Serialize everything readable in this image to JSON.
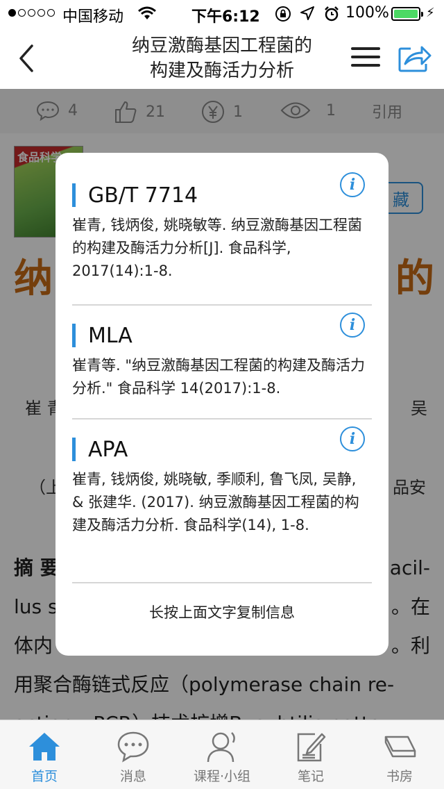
{
  "status_bar": {
    "carrier": "中国移动",
    "time": "下午6:12",
    "battery": "100%",
    "signal_bars_filled": 1,
    "signal_bars_total": 5
  },
  "nav": {
    "title_line1": "纳豆激酶基因工程菌的",
    "title_line2": "构建及酶活力分析",
    "back_icon": "chevron-left-icon",
    "menu_icon": "hamburger-icon",
    "share_icon": "share-icon"
  },
  "stats": {
    "comments": "4",
    "likes": "21",
    "price": "1",
    "views": "1",
    "cite_label": "引用"
  },
  "article": {
    "cover_title": "食品科学",
    "favorite_label": "藏",
    "title_left": "纳",
    "title_right": "的",
    "author_left": "崔 青",
    "author_right": "吴",
    "affil_left": "（上",
    "affil_right": "品安",
    "abstract": [
      {
        "left": "摘 要",
        "right": "acil-"
      },
      {
        "left": "lus s",
        "right": "。在"
      },
      {
        "left": "体内",
        "right": "。利"
      },
      {
        "left": "用聚合酶链式反应（polymerase chain re-",
        "right": ""
      },
      {
        "left": "action，PCR）技术扩增B. subtilis natto",
        "right": ""
      }
    ]
  },
  "modal": {
    "citations": [
      {
        "format": "GB/T 7714",
        "text": "崔青, 钱炳俊, 姚晓敏等. 纳豆激酶基因工程菌的构建及酶活力分析[J]. 食品科学, 2017(14):1-8."
      },
      {
        "format": "MLA",
        "text": "崔青等. \"纳豆激酶基因工程菌的构建及酶活力分析.\" 食品科学 14(2017):1-8."
      },
      {
        "format": "APA",
        "text": "崔青, 钱炳俊, 姚晓敏, 季顺利, 鲁飞凤, 吴静, & 张建华. (2017). 纳豆激酶基因工程菌的构建及酶活力分析. 食品科学(14), 1-8."
      }
    ],
    "info_icon_label": "i",
    "copy_hint": "长按上面文字复制信息"
  },
  "tabs": [
    {
      "label": "首页",
      "icon": "home-icon",
      "active": true
    },
    {
      "label": "消息",
      "icon": "message-icon",
      "active": false
    },
    {
      "label": "课程·小组",
      "icon": "person-icon",
      "active": false
    },
    {
      "label": "笔记",
      "icon": "note-icon",
      "active": false
    },
    {
      "label": "书房",
      "icon": "bookshelf-icon",
      "active": false
    }
  ],
  "colors": {
    "accent": "#2d8fdb",
    "title_orange": "#c96b16",
    "battery_green": "#4cd964"
  }
}
